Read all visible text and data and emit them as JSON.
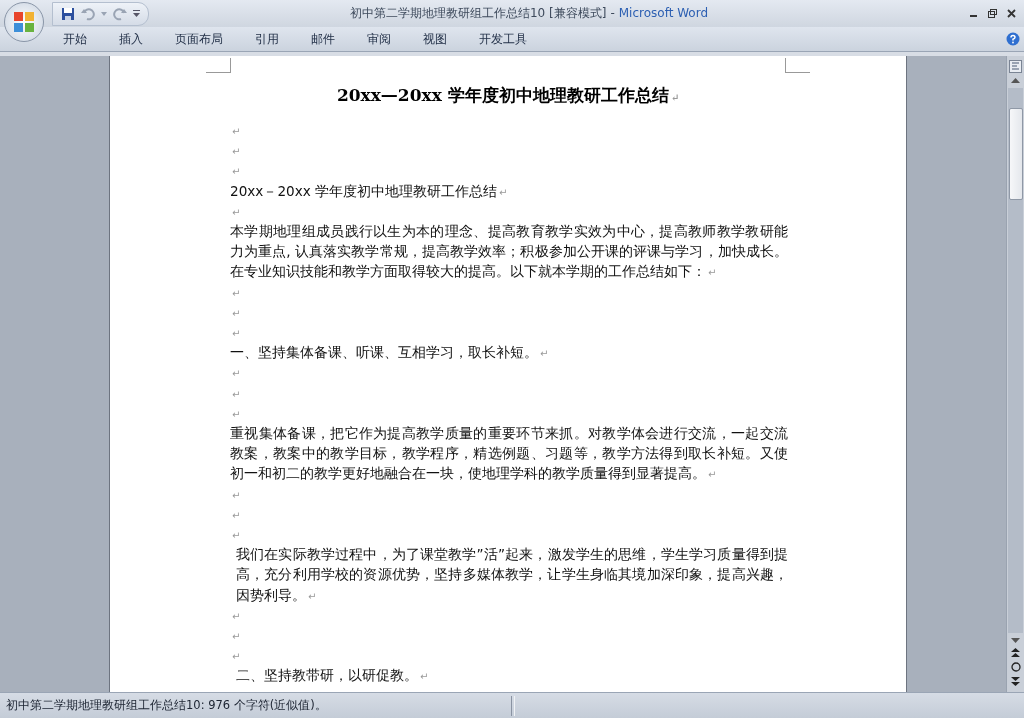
{
  "window": {
    "doc_title": "初中第二学期地理教研组工作总结10 [兼容模式]",
    "separator": "-",
    "app_name": "Microsoft Word"
  },
  "ribbon_tabs": [
    {
      "label": "开始"
    },
    {
      "label": "插入"
    },
    {
      "label": "页面布局"
    },
    {
      "label": "引用"
    },
    {
      "label": "邮件"
    },
    {
      "label": "审阅"
    },
    {
      "label": "视图"
    },
    {
      "label": "开发工具"
    }
  ],
  "document": {
    "title": "20xx—20xx 学年度初中地理教研工作总结",
    "title_mark": "↵",
    "paragraphs": [
      {
        "mark": "↵"
      },
      {
        "mark": "↵"
      },
      {
        "mark": "↵"
      },
      {
        "text": "20xx－20xx 学年度初中地理教研工作总结",
        "mark": "↵",
        "indented": false
      },
      {
        "mark": "↵"
      },
      {
        "text": "本学期地理组成员践行以生为本的理念、提高教育教学实效为中心，提高教师教学教研能力为重点, 认真落实教学常规，提高教学效率；积极参加公开课的评课与学习，加快成长。在专业知识技能和教学方面取得较大的提高。以下就本学期的工作总结如下：",
        "mark": "↵",
        "indented": false
      },
      {
        "mark": "↵"
      },
      {
        "mark": "↵"
      },
      {
        "mark": "↵"
      },
      {
        "text": "一、坚持集体备课、听课、互相学习，取长补短。",
        "mark": "↵",
        "indented": false
      },
      {
        "mark": "↵"
      },
      {
        "mark": "↵"
      },
      {
        "mark": "↵"
      },
      {
        "text": "重视集体备课，把它作为提高教学质量的重要环节来抓。对教学体会进行交流，一起交流教案，教案中的教学目标，教学程序，精选例题、习题等，教学方法得到取长补短。又使初一和初二的教学更好地融合在一块，使地理学科的教学质量得到显著提高。",
        "mark": "↵",
        "indented": false
      },
      {
        "mark": "↵"
      },
      {
        "mark": "↵"
      },
      {
        "mark": "↵"
      },
      {
        "text": "我们在实际教学过程中，为了课堂教学”活”起来，激发学生的思维，学生学习质量得到提高，充分利用学校的资源优势，坚持多媒体教学，让学生身临其境加深印象，提高兴趣，因势利导。",
        "mark": "↵",
        "indented": true
      },
      {
        "mark": "↵"
      },
      {
        "mark": "↵"
      },
      {
        "mark": "↵"
      },
      {
        "text": "二、坚持教带研，以研促教。",
        "mark": "↵",
        "indented": true
      }
    ]
  },
  "status_bar": {
    "text": "初中第二学期地理教研组工作总结10: 976 个字符(近似值)。"
  }
}
